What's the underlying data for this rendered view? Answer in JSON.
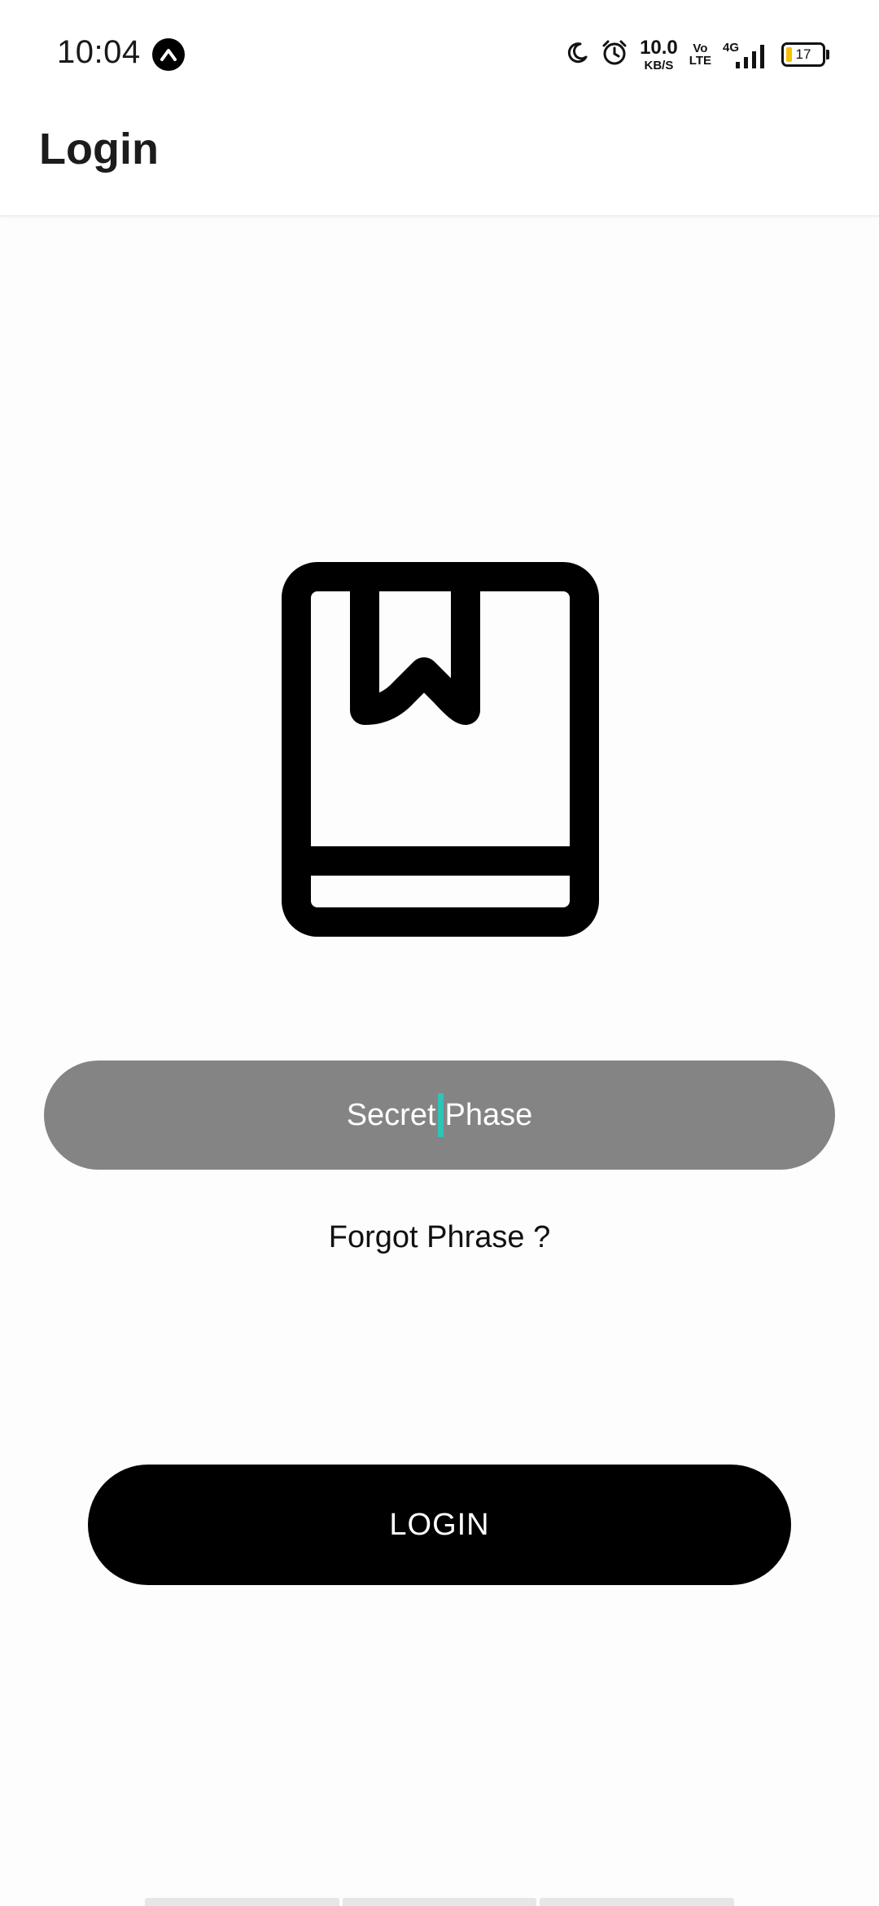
{
  "status_bar": {
    "time": "10:04",
    "net_speed_value": "10.0",
    "net_speed_unit": "KB/S",
    "volte_top": "Vo",
    "volte_bottom": "LTE",
    "network_type": "4G",
    "battery_level": "17",
    "icons": [
      "notification-app-icon",
      "moon-icon",
      "alarm-icon",
      "signal-icon",
      "battery-icon"
    ]
  },
  "app_bar": {
    "title": "Login"
  },
  "logo": {
    "icon": "book-bookmark-icon"
  },
  "form": {
    "phrase_part1": "Secret",
    "phrase_part2": "Phase",
    "forgot_link": "Forgot Phrase ?",
    "login_label": "LOGIN"
  },
  "colors": {
    "input_bg": "#848484",
    "cursor": "#2ec4b6",
    "button_bg": "#000000",
    "battery_fill": "#f2c200"
  }
}
